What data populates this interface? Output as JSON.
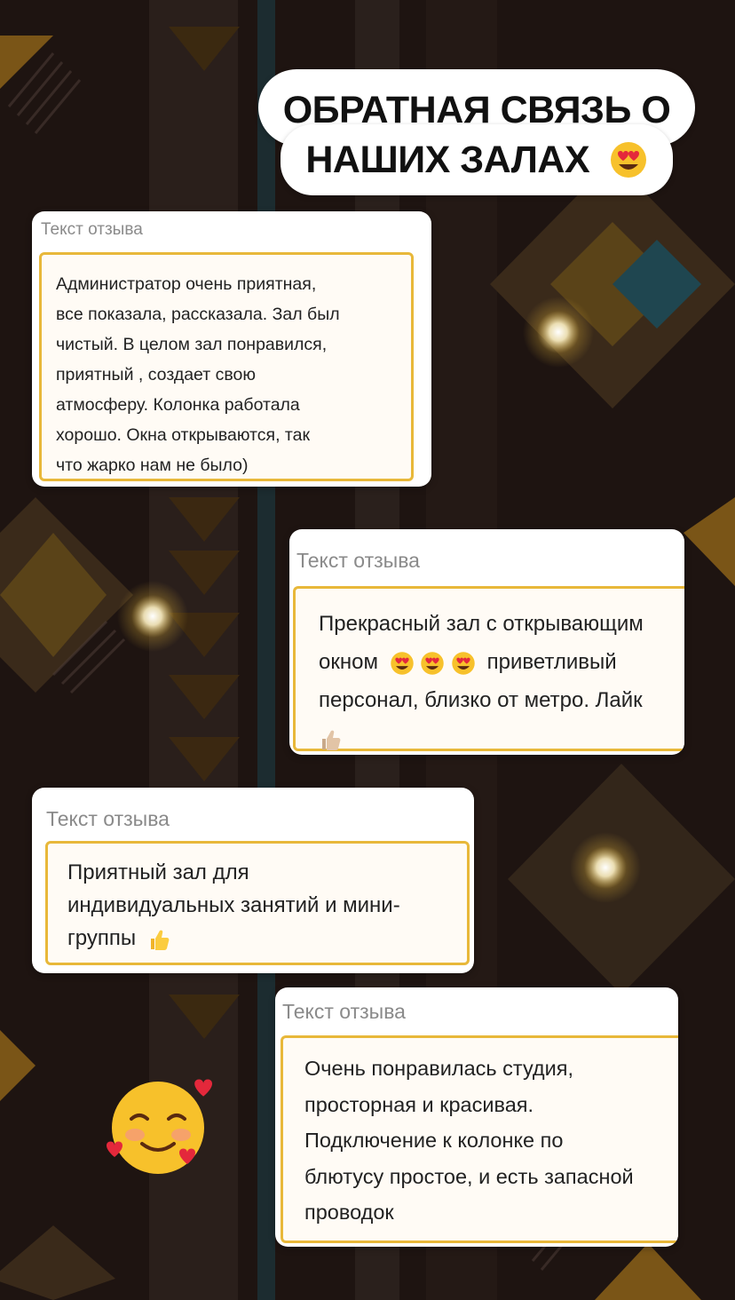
{
  "title": {
    "line1": "ОБРАТНАЯ СВЯЗЬ О",
    "line2": "НАШИХ ЗАЛАХ"
  },
  "icons": {
    "title_emoji": "heart-eyes-emoji",
    "decor_emoji": "smiling-face-with-hearts-emoji"
  },
  "colors": {
    "card_border": "#e8b83a",
    "background": "#1e1411",
    "accent_yellow": "#e0a526"
  },
  "reviews": [
    {
      "label": "Текст отзыва",
      "lines": [
        "Администратор очень приятная,",
        "все показала, рассказала. Зал был",
        "чистый. В целом зал понравился,",
        "приятный , создает свою",
        "атмосферу. Колонка работала",
        "хорошо. Окна открываются, так",
        "что жарко нам не было)"
      ]
    },
    {
      "label": "Текст отзыва",
      "lines": [
        "Прекрасный зал с открывающим",
        "окном",
        "приветливый",
        "персонал, близко от метро. Лайк"
      ]
    },
    {
      "label": "Текст отзыва",
      "lines": [
        "Приятный зал для",
        "индивидуальных занятий и мини-",
        "группы"
      ]
    },
    {
      "label": "Текст отзыва",
      "lines": [
        "Очень понравилась студия,",
        "просторная и красивая.",
        "Подключение к колонке по",
        "блютусу простое, и есть запасной",
        "проводок"
      ]
    }
  ]
}
